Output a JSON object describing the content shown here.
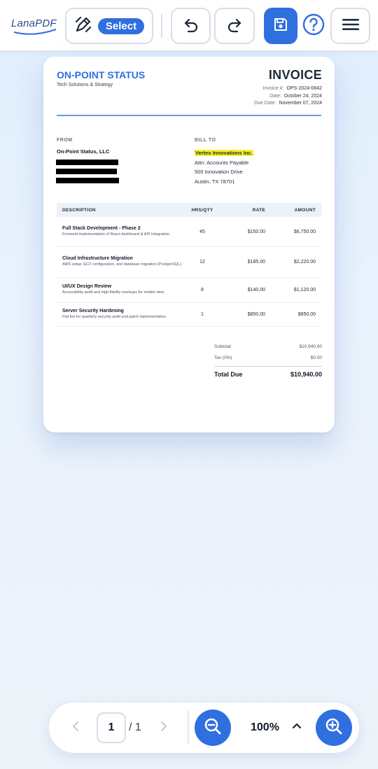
{
  "app": {
    "logo_text": "LanaPDF"
  },
  "toolbar": {
    "select_label": "Select",
    "icons": {
      "select_tool": "pen-tool-icon",
      "undo": "undo-icon",
      "redo": "redo-icon",
      "save": "save-icon",
      "help": "help-icon",
      "menu": "hamburger-menu-icon"
    },
    "accent": "#2f6fe0"
  },
  "invoice": {
    "company": "ON-POINT STATUS",
    "tagline": "Tech Solutions & Strategy",
    "title": "INVOICE",
    "meta": [
      {
        "label": "Invoice #:",
        "value": "OPS-2024-0842"
      },
      {
        "label": "Date:",
        "value": "October 24, 2024"
      },
      {
        "label": "Due Date:",
        "value": "November 07, 2024"
      }
    ],
    "from_heading": "FROM",
    "from_name": "On-Point Status, LLC",
    "bill_to_heading": "BILL TO",
    "bill_to": {
      "name": "Vertex Innovations Inc.",
      "attn": "Attn: Accounts Payable",
      "street": "500 Innovation Drive",
      "city": "Austin, TX 78701"
    },
    "table": {
      "headers": [
        "DESCRIPTION",
        "HRS/QTY",
        "RATE",
        "AMOUNT"
      ],
      "rows": [
        {
          "title": "Full Stack Development - Phase 2",
          "desc": "Frontend implementation of React dashboard & API integration.",
          "qty": "45",
          "rate": "$150.00",
          "amount": "$6,750.00"
        },
        {
          "title": "Cloud Infrastructure Migration",
          "desc": "AWS setup, EC2 configuration, and database migration (PostgreSQL).",
          "qty": "12",
          "rate": "$185.00",
          "amount": "$2,220.00"
        },
        {
          "title": "UI/UX Design Review",
          "desc": "Accessibility audit and high-fidelity mockups for mobile view.",
          "qty": "8",
          "rate": "$140.00",
          "amount": "$1,120.00"
        },
        {
          "title": "Server Security Hardening",
          "desc": "Flat fee for quarterly security audit and patch implementation.",
          "qty": "1",
          "rate": "$850.00",
          "amount": "$850.00"
        }
      ]
    },
    "totals": {
      "subtotal_label": "Subtotal",
      "subtotal": "$10,940.00",
      "tax_label": "Tax (0%)",
      "tax": "$0.00",
      "due_label": "Total Due",
      "due": "$10,940.00"
    }
  },
  "pager": {
    "current_page": "1",
    "total_pages": "/ 1",
    "zoom": "100%",
    "icons": {
      "prev": "chevron-left-icon",
      "next": "chevron-right-icon",
      "zoom_out": "zoom-out-icon",
      "zoom_in": "zoom-in-icon",
      "zoom_menu": "chevron-up-icon"
    }
  }
}
